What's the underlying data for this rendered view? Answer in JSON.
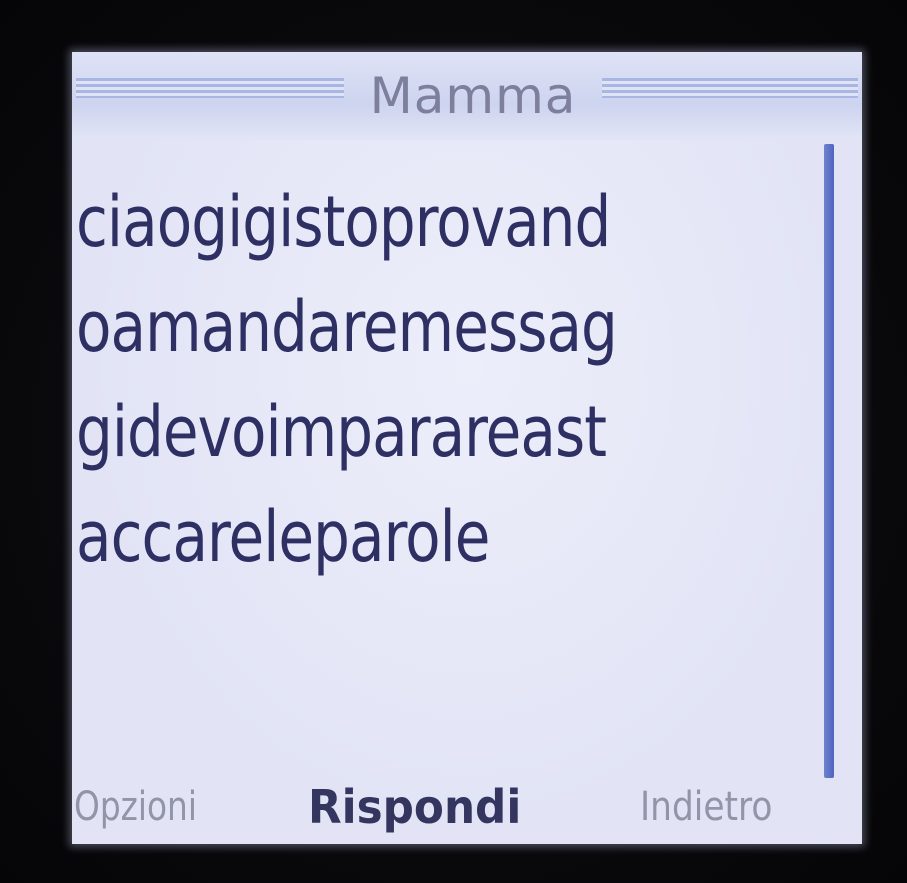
{
  "header": {
    "title": "Mamma"
  },
  "message": {
    "lines": [
      "ciaogigistoprovand",
      "oamandaremessag",
      "gidevoimparareast",
      "accareleparole"
    ]
  },
  "softkeys": {
    "left": "Opzioni",
    "center": "Rispondi",
    "right": "Indietro"
  },
  "colors": {
    "screen_background": "#e6e8f8",
    "text": "#2e2f63",
    "title_text": "#7d7f9c",
    "scrollbar": "#5a6dc6"
  },
  "scrollbar": {
    "position_fraction": 0,
    "visible_fraction": 1
  }
}
